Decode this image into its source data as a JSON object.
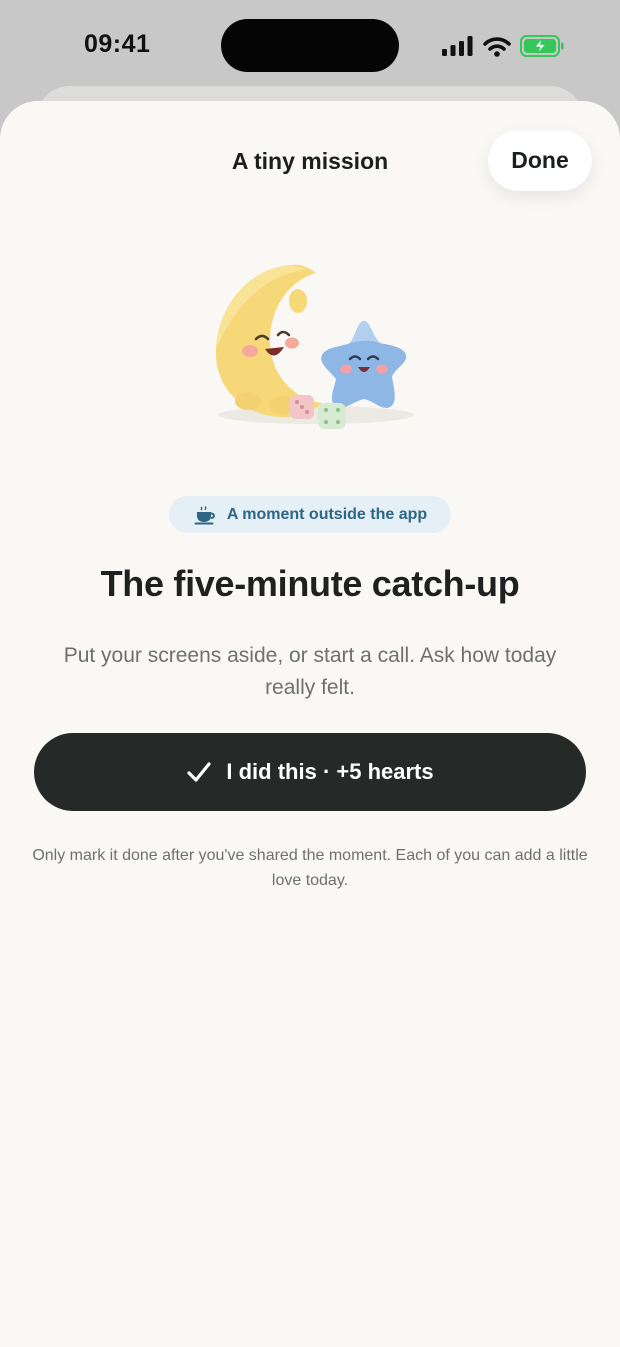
{
  "status_bar": {
    "time": "09:41",
    "icons": [
      "cellular-signal-icon",
      "wifi-icon",
      "battery-charging-icon"
    ],
    "battery_color": "#35c759"
  },
  "sheet": {
    "title": "A tiny mission",
    "done_label": "Done"
  },
  "illustration": {
    "name": "moon-and-star-illustration"
  },
  "tag": {
    "icon": "tea-cup-icon",
    "label": "A moment outside the app"
  },
  "headline": "The five-minute catch-up",
  "subtext": "Put your screens aside, or start a call. Ask how today really felt.",
  "cta": {
    "icon": "checkmark-icon",
    "label": "I did this · +5 hearts"
  },
  "footnote": "Only mark it done after you've shared the moment. Each of you can add a little love today.",
  "colors": {
    "sheet_background": "#f9f8f5",
    "cta_background": "#252a29",
    "tag_background": "#e4eff6",
    "tag_text": "#2f6585"
  }
}
